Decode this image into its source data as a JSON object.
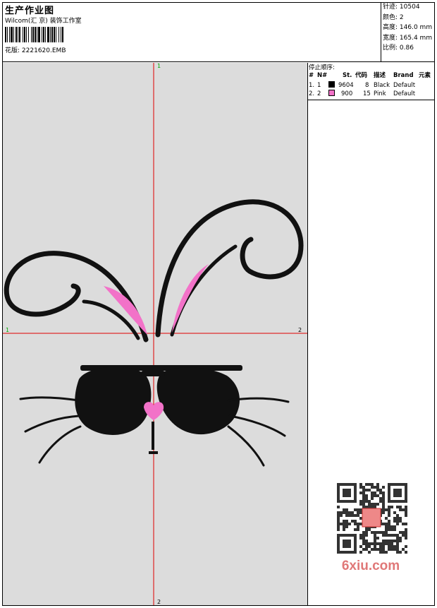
{
  "header": {
    "title": "生产作业图",
    "company": "Wilcom(汇 京) 装饰工作室",
    "design_label": "花版:",
    "design_value": "2221620.EMB"
  },
  "specs": {
    "stitches_label": "针迹:",
    "stitches": "10504",
    "colors_label": "颜色:",
    "colors": "2",
    "height_label": "高度:",
    "height": "146.0 mm",
    "width_label": "宽度:",
    "width": "165.4 mm",
    "scale_label": "比例:",
    "scale": "0.86"
  },
  "stop_sequence": {
    "title": "停止顺序:",
    "headers": [
      "#",
      "N#",
      "St.",
      "代码",
      "描述",
      "Brand",
      "元素"
    ],
    "rows": [
      {
        "idx": "1.",
        "n": "1",
        "color": "#000000",
        "code": "9604",
        "stitches": "8",
        "desc": "Black",
        "brand": "Default"
      },
      {
        "idx": "2.",
        "n": "2",
        "color": "#f272c8",
        "code": "900",
        "stitches": "15",
        "desc": "Pink",
        "brand": "Default"
      }
    ]
  },
  "crosshair": {
    "top": "1",
    "bottom": "2",
    "left": "1",
    "right": "2"
  },
  "watermark": {
    "text": "6xiu.com"
  },
  "colors": {
    "thread_1": "#111111",
    "thread_2": "#f272c8",
    "guide": "#e00000",
    "canvas": "#dcdcdc"
  }
}
